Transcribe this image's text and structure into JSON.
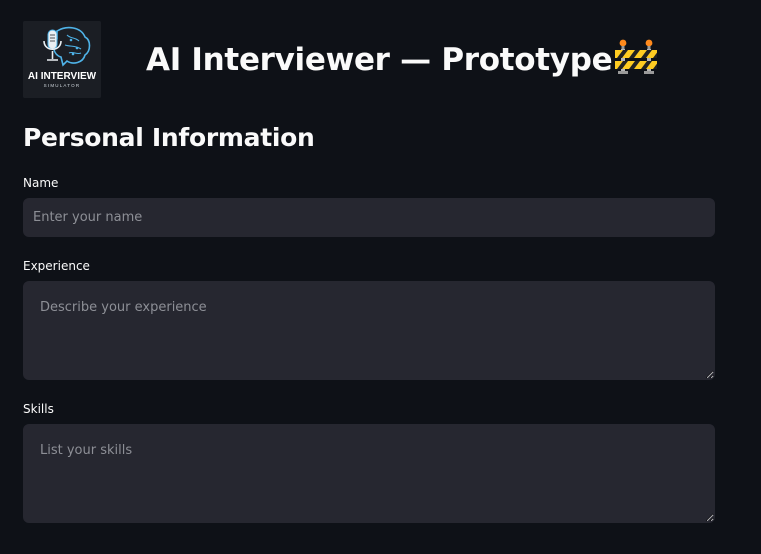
{
  "header": {
    "logo": {
      "line1": "AI INTERVIEW",
      "line2": "SIMULATOR"
    },
    "title": "AI Interviewer — Prototype"
  },
  "form": {
    "section_title": "Personal Information",
    "name": {
      "label": "Name",
      "placeholder": "Enter your name",
      "value": ""
    },
    "experience": {
      "label": "Experience",
      "placeholder": "Describe your experience",
      "value": ""
    },
    "skills": {
      "label": "Skills",
      "placeholder": "List your skills",
      "value": ""
    }
  },
  "icons": {
    "title_icon": "construction-barrier-icon",
    "logo_icon": "microphone-brain-icon"
  },
  "colors": {
    "background": "#0e1117",
    "input_background": "#262730",
    "text": "#fafafa",
    "placeholder": "#8d8f96",
    "logo_accent": "#4fb3e8"
  }
}
